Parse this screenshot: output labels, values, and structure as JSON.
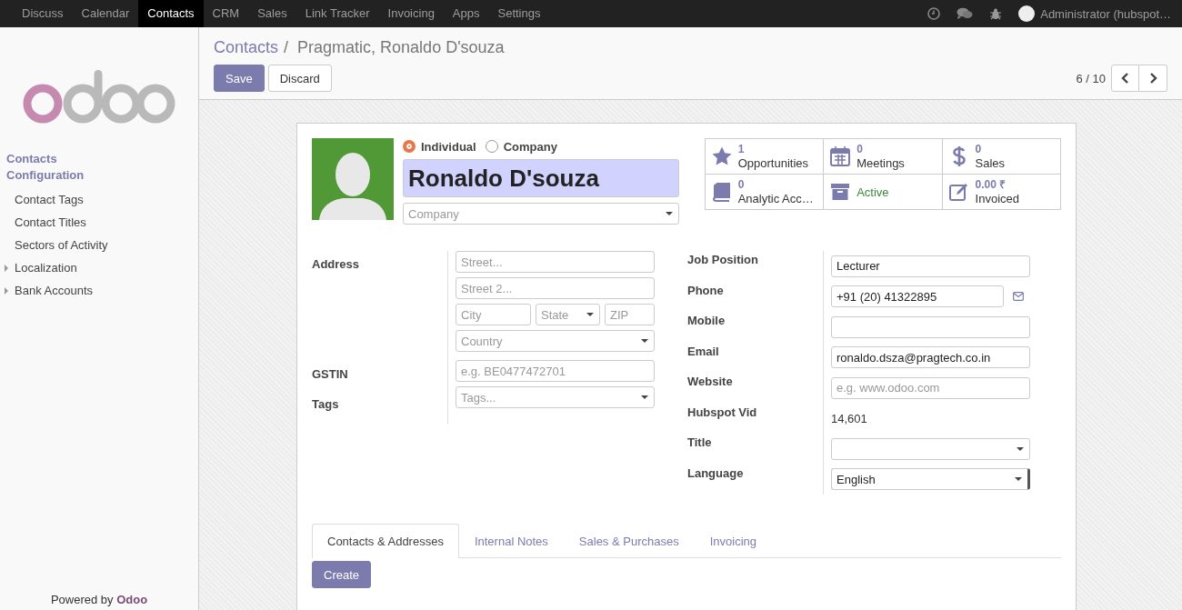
{
  "top_menu": {
    "items": [
      {
        "label": "Discuss",
        "selected": false
      },
      {
        "label": "Calendar",
        "selected": false
      },
      {
        "label": "Contacts",
        "selected": true
      },
      {
        "label": "CRM",
        "selected": false
      },
      {
        "label": "Sales",
        "selected": false
      },
      {
        "label": "Link Tracker",
        "selected": false
      },
      {
        "label": "Invoicing",
        "selected": false
      },
      {
        "label": "Apps",
        "selected": false
      },
      {
        "label": "Settings",
        "selected": false
      }
    ],
    "user": "Administrator (hubspot…"
  },
  "sidebar": {
    "menus": [
      {
        "label": "Contacts"
      },
      {
        "label": "Configuration"
      }
    ],
    "items": [
      {
        "label": "Contact Tags",
        "kind": "link"
      },
      {
        "label": "Contact Titles",
        "kind": "link"
      },
      {
        "label": "Sectors of Activity",
        "kind": "link"
      },
      {
        "label": "Localization",
        "kind": "group",
        "expanded": false
      },
      {
        "label": "Bank Accounts",
        "kind": "group",
        "expanded": false
      }
    ],
    "powered_label": "Powered by",
    "powered_brand": "Odoo"
  },
  "breadcrumb": {
    "parent": "Contacts",
    "separator": "/",
    "current": "Pragmatic, Ronaldo D'souza"
  },
  "buttons": {
    "save": "Save",
    "discard": "Discard"
  },
  "pager": "6 / 10",
  "form": {
    "type_options": [
      {
        "label": "Individual",
        "selected": true
      },
      {
        "label": "Company",
        "selected": false
      }
    ],
    "name": "Ronaldo D'souza",
    "company_placeholder": "Company",
    "stats": [
      {
        "kind": "count",
        "count": "1",
        "label": "Opportunities"
      },
      {
        "kind": "count",
        "count": "0",
        "label": "Meetings"
      },
      {
        "kind": "count",
        "count": "0",
        "label": "Sales"
      },
      {
        "kind": "count",
        "count": "0",
        "label": "Analytic Acc…"
      },
      {
        "kind": "toggle",
        "label": "Active",
        "on": true
      },
      {
        "kind": "count",
        "count": "0.00 ₹",
        "label": "Invoiced"
      }
    ],
    "address": {
      "label": "Address",
      "street": {
        "placeholder": "Street..."
      },
      "street2": {
        "placeholder": "Street 2..."
      },
      "city": {
        "placeholder": "City"
      },
      "state": {
        "placeholder": "State"
      },
      "zip": {
        "placeholder": "ZIP"
      },
      "country": {
        "placeholder": "Country"
      }
    },
    "gstin": {
      "label": "GSTIN",
      "placeholder": "e.g. BE0477472701"
    },
    "tags": {
      "label": "Tags",
      "placeholder": "Tags..."
    },
    "right_fields": [
      {
        "label": "Job Position",
        "kind": "input",
        "value": "Lecturer"
      },
      {
        "label": "Phone",
        "kind": "phone",
        "value": "+91 (20) 41322895"
      },
      {
        "label": "Mobile",
        "kind": "input"
      },
      {
        "label": "Email",
        "kind": "input",
        "value": "ronaldo.dsza@pragtech.co.in"
      },
      {
        "label": "Website",
        "kind": "input",
        "placeholder": "e.g. www.odoo.com"
      },
      {
        "label": "Hubspot Vid",
        "kind": "text",
        "value": "14,601"
      },
      {
        "label": "Title",
        "kind": "select"
      },
      {
        "label": "Language",
        "kind": "native-select",
        "value": "English"
      }
    ],
    "tabs": [
      {
        "label": "Contacts & Addresses",
        "selected": true
      },
      {
        "label": "Internal Notes",
        "selected": false
      },
      {
        "label": "Sales & Purchases",
        "selected": false
      },
      {
        "label": "Invoicing",
        "selected": false
      }
    ],
    "create_button": "Create"
  }
}
